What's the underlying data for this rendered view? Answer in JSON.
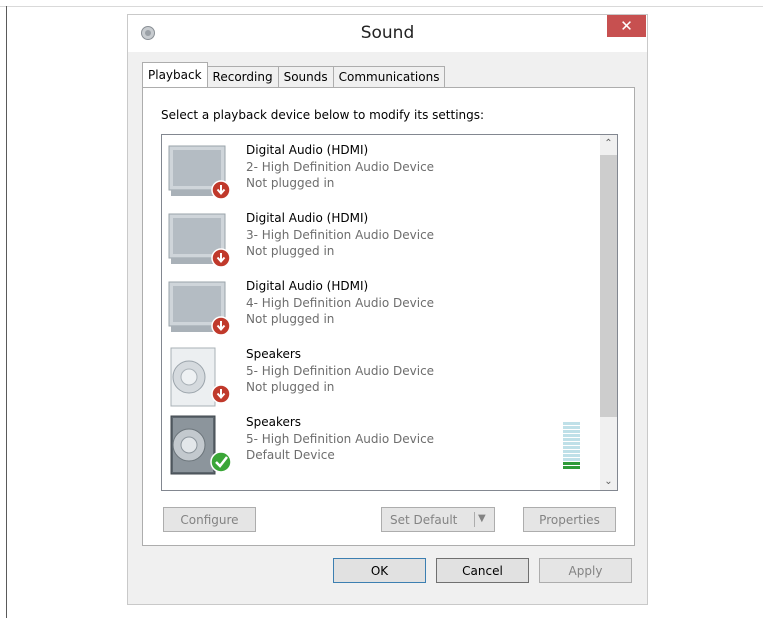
{
  "window": {
    "title": "Sound",
    "close_glyph": "✕"
  },
  "tabs": [
    {
      "label": "Playback",
      "active": true
    },
    {
      "label": "Recording",
      "active": false
    },
    {
      "label": "Sounds",
      "active": false
    },
    {
      "label": "Communications",
      "active": false
    }
  ],
  "instructions": "Select a playback device below to modify its settings:",
  "devices": [
    {
      "name": "Digital Audio (HDMI)",
      "sub": "2- High Definition Audio Device",
      "status": "Not plugged in",
      "icon": "monitor-icon",
      "badge": "unplugged-badge-icon"
    },
    {
      "name": "Digital Audio (HDMI)",
      "sub": "3- High Definition Audio Device",
      "status": "Not plugged in",
      "icon": "monitor-icon",
      "badge": "unplugged-badge-icon"
    },
    {
      "name": "Digital Audio (HDMI)",
      "sub": "4- High Definition Audio Device",
      "status": "Not plugged in",
      "icon": "monitor-icon",
      "badge": "unplugged-badge-icon"
    },
    {
      "name": "Speakers",
      "sub": "5- High Definition Audio Device",
      "status": "Not plugged in",
      "icon": "speaker-icon",
      "badge": "unplugged-badge-icon"
    },
    {
      "name": "Speakers",
      "sub": "5- High Definition Audio Device",
      "status": "Default Device",
      "icon": "speaker-icon",
      "badge": "default-check-icon"
    }
  ],
  "buttons": {
    "configure": "Configure",
    "set_default": "Set Default",
    "properties": "Properties",
    "ok": "OK",
    "cancel": "Cancel",
    "apply": "Apply"
  },
  "level_meter": {
    "lit_segments": 2,
    "total_segments": 12
  },
  "colors": {
    "close": "#c75050",
    "unplugged_badge": "#c0392b",
    "default_badge": "#3aa637",
    "meter_on": "#2e9b3a",
    "meter_off": "#bfe0e8"
  }
}
